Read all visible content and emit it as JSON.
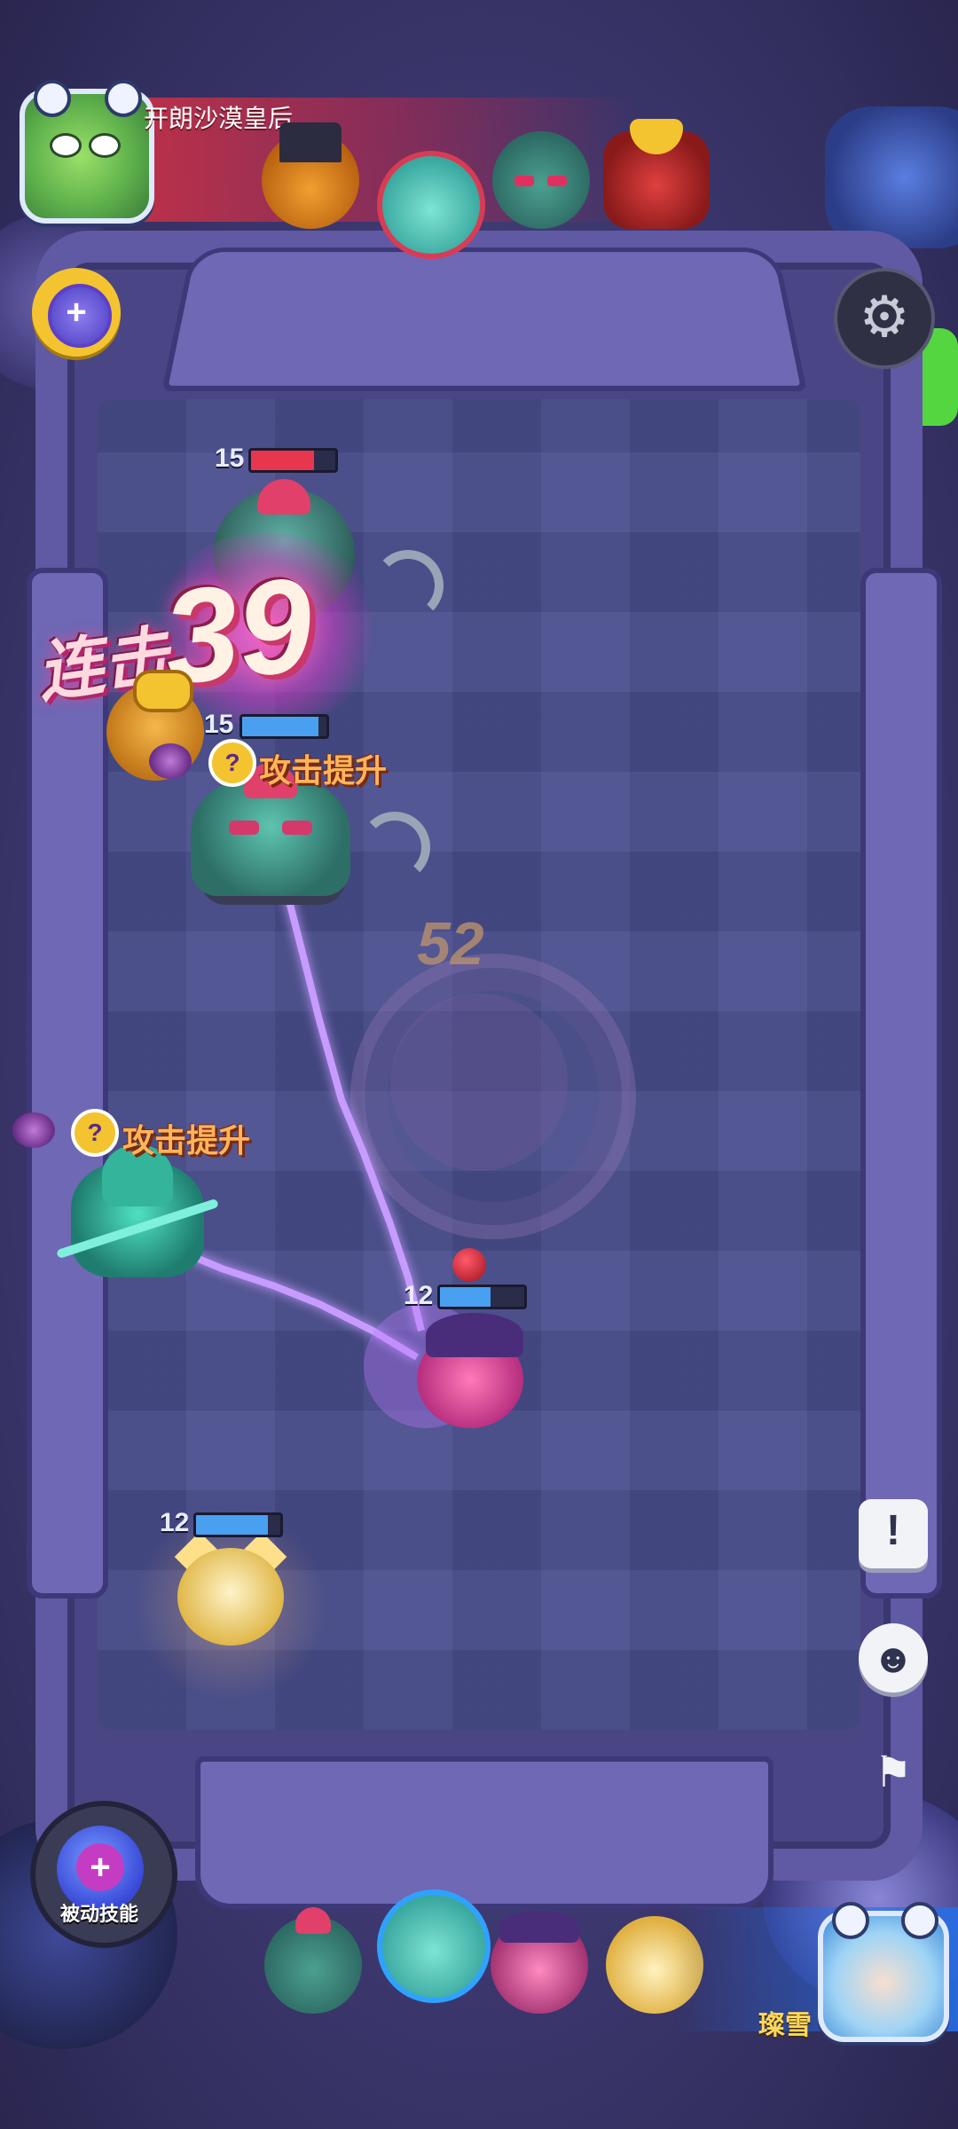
{
  "top_bar": {
    "opponent_name": "开朗沙漠皇后"
  },
  "center": {
    "counter": "52"
  },
  "combo": {
    "label": "连击",
    "count": "39"
  },
  "units": {
    "enemy_top": {
      "level": "15",
      "hp_fraction": 0.75,
      "hp_color": "#e8364e"
    },
    "ogre": {
      "level": "15",
      "hp_fraction": 0.9,
      "hp_color": "#4aa0f0"
    },
    "witch": {
      "level": "12",
      "hp_fraction": 0.6,
      "hp_color": "#4aa0f0"
    },
    "cat": {
      "level": "12",
      "hp_fraction": 0.85,
      "hp_color": "#4aa0f0"
    }
  },
  "buffs": {
    "ogre_buff": {
      "icon": "?",
      "text": "攻击提升"
    },
    "assassin_buff": {
      "icon": "?",
      "text": "攻击提升"
    }
  },
  "controls": {
    "passive_skill_label": "被动技能",
    "report_icon": "!",
    "emote_icon": "☻",
    "surrender_icon": "⚑",
    "settings_icon": "⚙",
    "buff_button_icon": "+"
  },
  "player": {
    "name": "璨雪"
  },
  "colors": {
    "enemy_banner": "#d2324a",
    "player_banner": "#2a6ee6",
    "lightning": "#b57bff",
    "combo_text": "#fff2e4"
  }
}
